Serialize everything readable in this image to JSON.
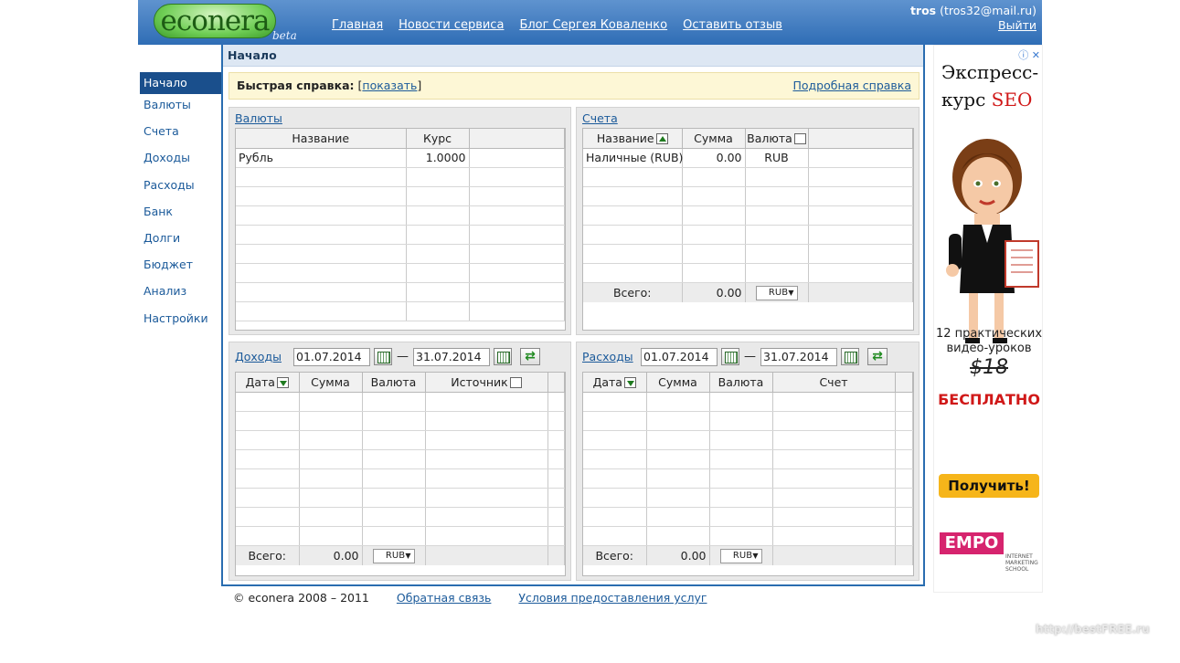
{
  "header": {
    "logo_text": "econera",
    "logo_beta": "beta",
    "nav": [
      "Главная",
      "Новости сервиса",
      "Блог Сергея Коваленко",
      "Оставить отзыв"
    ],
    "user_name": "tros",
    "user_email": "(tros32@mail.ru)",
    "logout": "Выйти"
  },
  "sidebar": {
    "items": [
      "Начало",
      "Валюты",
      "Счета",
      "Доходы",
      "Расходы",
      "Банк",
      "Долги",
      "Бюджет",
      "Анализ",
      "Настройки"
    ],
    "active": "Начало"
  },
  "main": {
    "title": "Начало",
    "help": {
      "label": "Быстрая справка:",
      "bracket_open": "[",
      "show": "показать",
      "bracket_close": "]",
      "detailed": "Подробная справка"
    }
  },
  "currencies": {
    "title": "Валюты",
    "columns": [
      "Название",
      "Курс"
    ],
    "rows": [
      [
        "Рубль",
        "1.0000"
      ]
    ]
  },
  "accounts": {
    "title": "Счета",
    "columns": [
      "Название",
      "Сумма",
      "Валюта"
    ],
    "rows": [
      [
        "Наличные (RUB)",
        "0.00",
        "RUB"
      ]
    ],
    "total_label": "Всего:",
    "total_value": "0.00",
    "total_currency": "RUB"
  },
  "incomes": {
    "title": "Доходы",
    "date_from": "01.07.2014",
    "dash": "—",
    "date_to": "31.07.2014",
    "columns": [
      "Дата",
      "Сумма",
      "Валюта",
      "Источник"
    ],
    "total_label": "Всего:",
    "total_value": "0.00",
    "total_currency": "RUB"
  },
  "expenses": {
    "title": "Расходы",
    "date_from": "01.07.2014",
    "dash": "—",
    "date_to": "31.07.2014",
    "columns": [
      "Дата",
      "Сумма",
      "Валюта",
      "Счет"
    ],
    "total_label": "Всего:",
    "total_value": "0.00",
    "total_currency": "RUB"
  },
  "footer": {
    "copyright": "© econera 2008 – 2011",
    "feedback": "Обратная связь",
    "terms": "Условия предоставления услуг"
  },
  "ad": {
    "title_line1": "Экспресс-",
    "title_line2a": "курс ",
    "title_line2b": "SEO",
    "text": "12 практических видео-уроков",
    "price": "$18",
    "free": "БЕСПЛАТНО",
    "button": "Получить!",
    "logo": "EMPO",
    "logo_sub": "INTERNET MARKETING SCHOOL",
    "info_icon": "info-icon",
    "close_icon": "close-icon"
  },
  "watermark": "http://bestFREE.ru"
}
